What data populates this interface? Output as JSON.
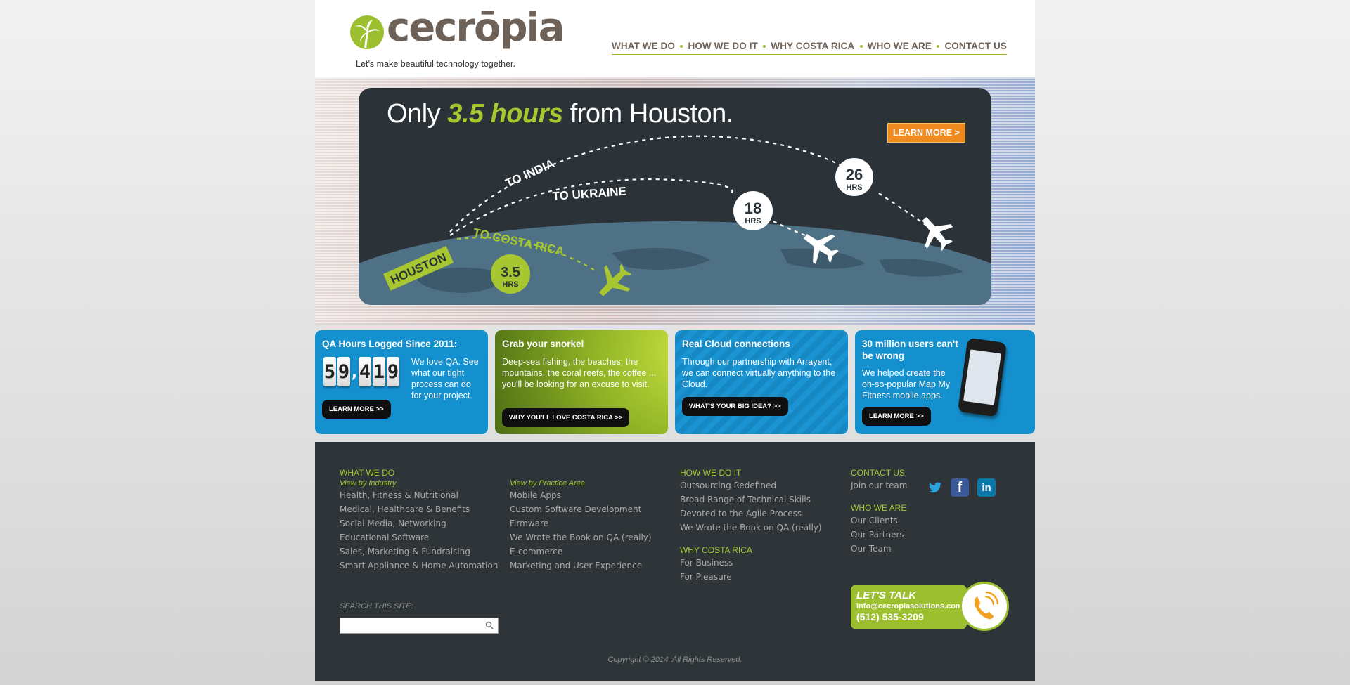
{
  "brand": {
    "name": "cecrōpia",
    "tagline": "Let’s make beautiful technology together."
  },
  "nav": {
    "items": [
      "WHAT WE DO",
      "HOW WE DO IT",
      "WHY COSTA RICA",
      "WHO WE ARE",
      "CONTACT US"
    ]
  },
  "hero": {
    "title_pre": "Only ",
    "title_highlight": "3.5 hours",
    "title_post": " from Houston.",
    "cta": "LEARN MORE >",
    "origin": "HOUSTON",
    "routes": [
      "TO INDIA",
      "TO UKRAINE",
      "TO COSTA RICA"
    ],
    "hours": [
      {
        "value": "26",
        "unit": "HRS"
      },
      {
        "value": "18",
        "unit": "HRS"
      },
      {
        "value": "3.5",
        "unit": "HRS"
      }
    ]
  },
  "features": {
    "qa": {
      "title": "QA Hours Logged Since 2011:",
      "counter": "59,419",
      "text": "We love QA. See what our tight process can do for your project.",
      "button": "LEARN MORE >>"
    },
    "snorkel": {
      "title": "Grab your snorkel",
      "text": "Deep-sea fishing, the beaches, the mountains, the coral reefs, the coffee ... you'll be looking for an excuse to visit.",
      "button": "WHY YOU'LL LOVE COSTA RICA >>"
    },
    "cloud": {
      "title": "Real Cloud connections",
      "text": "Through our partnership with Arrayent, we can connect virtually anything to the Cloud.",
      "button": "WHAT'S YOUR BIG IDEA? >>"
    },
    "users": {
      "title": "30 million users can't be wrong",
      "text": "We helped create the oh-so-popular Map My Fitness mobile apps.",
      "button": "LEARN MORE >>"
    }
  },
  "footer": {
    "what_we_do": {
      "heading": "WHAT WE DO",
      "sub_industry": "View by Industry",
      "industry": [
        "Health, Fitness & Nutritional",
        "Medical, Healthcare & Benefits",
        "Social Media, Networking",
        "Educational Software",
        "Sales, Marketing & Fundraising",
        "Smart Appliance & Home Automation"
      ],
      "sub_practice": "View by Practice Area",
      "practice": [
        "Mobile Apps",
        "Custom Software Development",
        "Firmware",
        "We Wrote the Book on QA (really)",
        "E-commerce",
        "Marketing and User Experience"
      ]
    },
    "how_we_do_it": {
      "heading": "HOW WE DO IT",
      "links": [
        "Outsourcing Redefined",
        "Broad Range of Technical Skills",
        "Devoted to the Agile Process",
        "We Wrote the Book on QA (really)"
      ]
    },
    "why_costa_rica": {
      "heading": "WHY COSTA RICA",
      "links": [
        "For Business",
        "For Pleasure"
      ]
    },
    "contact_us": {
      "heading": "CONTACT US",
      "links": [
        "Join our team"
      ]
    },
    "who_we_are": {
      "heading": "WHO WE ARE",
      "links": [
        "Our Clients",
        "Our Partners",
        "Our Team"
      ]
    },
    "search_label": "SEARCH THIS SITE:",
    "lets_talk": {
      "title": "LET'S TALK",
      "email": "info@cecropiasolutions.com",
      "phone": "(512) 535-3209"
    },
    "copyright": "Copyright © 2014. All Rights Reserved."
  },
  "colors": {
    "accent_green": "#9cbf2f",
    "brand_brown": "#6e6157",
    "cta_orange": "#ef8a21",
    "box_blue": "#1590cf",
    "footer_bg": "#2e3438"
  },
  "icons": [
    "palm-logo-icon",
    "airplane-icon",
    "search-icon",
    "twitter-icon",
    "facebook-icon",
    "linkedin-icon",
    "phone-icon"
  ]
}
